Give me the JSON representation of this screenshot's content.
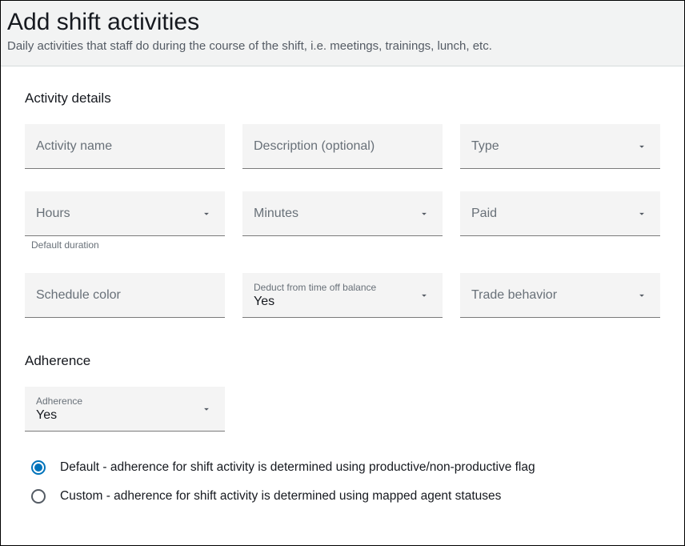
{
  "header": {
    "title": "Add shift activities",
    "subtitle": "Daily activities that staff do during the course of the shift, i.e. meetings, trainings, lunch, etc."
  },
  "activity_details": {
    "section_title": "Activity details",
    "activity_name_placeholder": "Activity name",
    "description_placeholder": "Description (optional)",
    "type_placeholder": "Type",
    "hours_placeholder": "Hours",
    "minutes_placeholder": "Minutes",
    "paid_placeholder": "Paid",
    "duration_helper": "Default duration",
    "schedule_color_placeholder": "Schedule color",
    "deduct_label": "Deduct from time off balance",
    "deduct_value": "Yes",
    "trade_behavior_placeholder": "Trade behavior"
  },
  "adherence": {
    "section_title": "Adherence",
    "field_label": "Adherence",
    "field_value": "Yes",
    "radio_default": "Default - adherence for shift activity is determined using productive/non-productive flag",
    "radio_custom": "Custom - adherence for shift activity is determined using mapped agent statuses",
    "selected": "default"
  }
}
